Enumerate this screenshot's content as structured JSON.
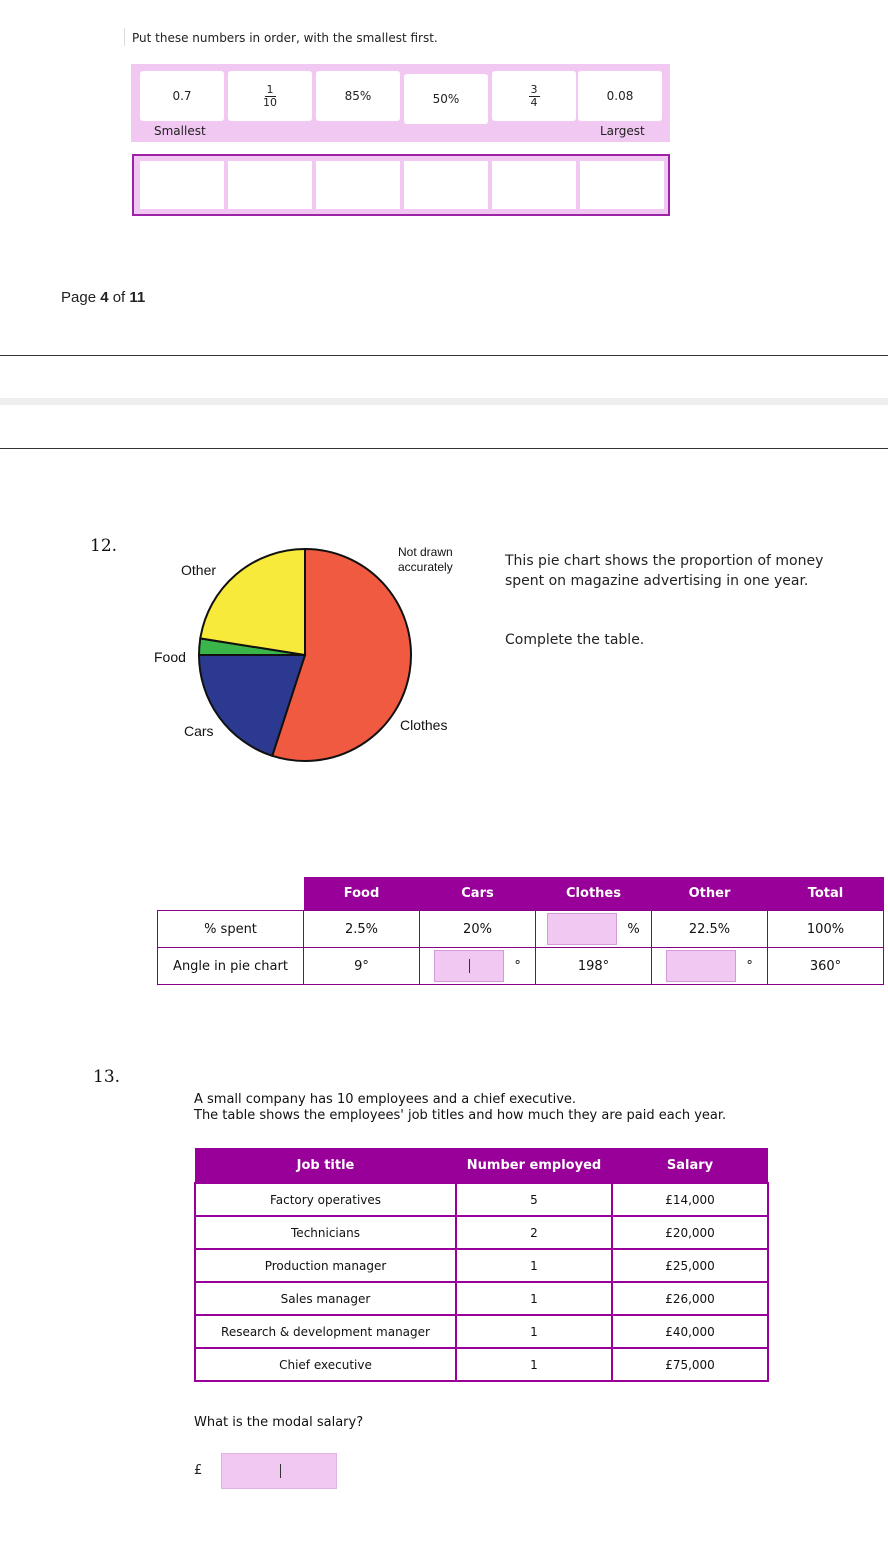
{
  "q11": {
    "instruction": "Put these numbers in order, with the smallest first.",
    "cards": [
      {
        "type": "text",
        "text": "0.7"
      },
      {
        "type": "fraction",
        "num": "1",
        "den": "10"
      },
      {
        "type": "text",
        "text": "85%"
      },
      {
        "type": "text",
        "text": "50%"
      },
      {
        "type": "fraction",
        "num": "3",
        "den": "4"
      },
      {
        "type": "text",
        "text": "0.08"
      }
    ],
    "smallest_label": "Smallest",
    "largest_label": "Largest"
  },
  "page_indicator": {
    "prefix": "Page ",
    "current": "4",
    "of": " of ",
    "total": "11"
  },
  "q12": {
    "number": "12.",
    "note_line1": "Not drawn",
    "note_line2": "accurately",
    "description": "This pie chart shows the proportion of money spent on magazine advertising in one year.",
    "instruction": "Complete the table.",
    "pie_labels": {
      "other": "Other",
      "food": "Food",
      "cars": "Cars",
      "clothes": "Clothes"
    },
    "table": {
      "headers": [
        "",
        "Food",
        "Cars",
        "Clothes",
        "Other",
        "Total"
      ],
      "row1_label": "% spent",
      "row1": {
        "food": "2.5%",
        "cars": "20%",
        "clothes_unit": "%",
        "other": "22.5%",
        "total": "100%"
      },
      "row2_label": "Angle in pie chart",
      "row2": {
        "food": "9°",
        "cars_unit": "°",
        "clothes": "198°",
        "other_unit": "°",
        "total": "360°"
      }
    }
  },
  "chart_data": {
    "type": "pie",
    "categories": [
      "Clothes",
      "Cars",
      "Food",
      "Other"
    ],
    "values": [
      55,
      20,
      2.5,
      22.5
    ],
    "colors": [
      "#f05a40",
      "#2b3990",
      "#3ab54a",
      "#f7ea3a"
    ]
  },
  "q13": {
    "number": "13.",
    "intro_line1": "A small company has 10 employees and a chief executive.",
    "intro_line2": "The table shows the employees' job titles and how much they are paid each year.",
    "headers": [
      "Job title",
      "Number employed",
      "Salary"
    ],
    "rows": [
      [
        "Factory operatives",
        "5",
        "£14,000"
      ],
      [
        "Technicians",
        "2",
        "£20,000"
      ],
      [
        "Production manager",
        "1",
        "£25,000"
      ],
      [
        "Sales manager",
        "1",
        "£26,000"
      ],
      [
        "Research & development manager",
        "1",
        "£40,000"
      ],
      [
        "Chief executive",
        "1",
        "£75,000"
      ]
    ],
    "question": "What is the modal salary?",
    "currency": "£"
  }
}
